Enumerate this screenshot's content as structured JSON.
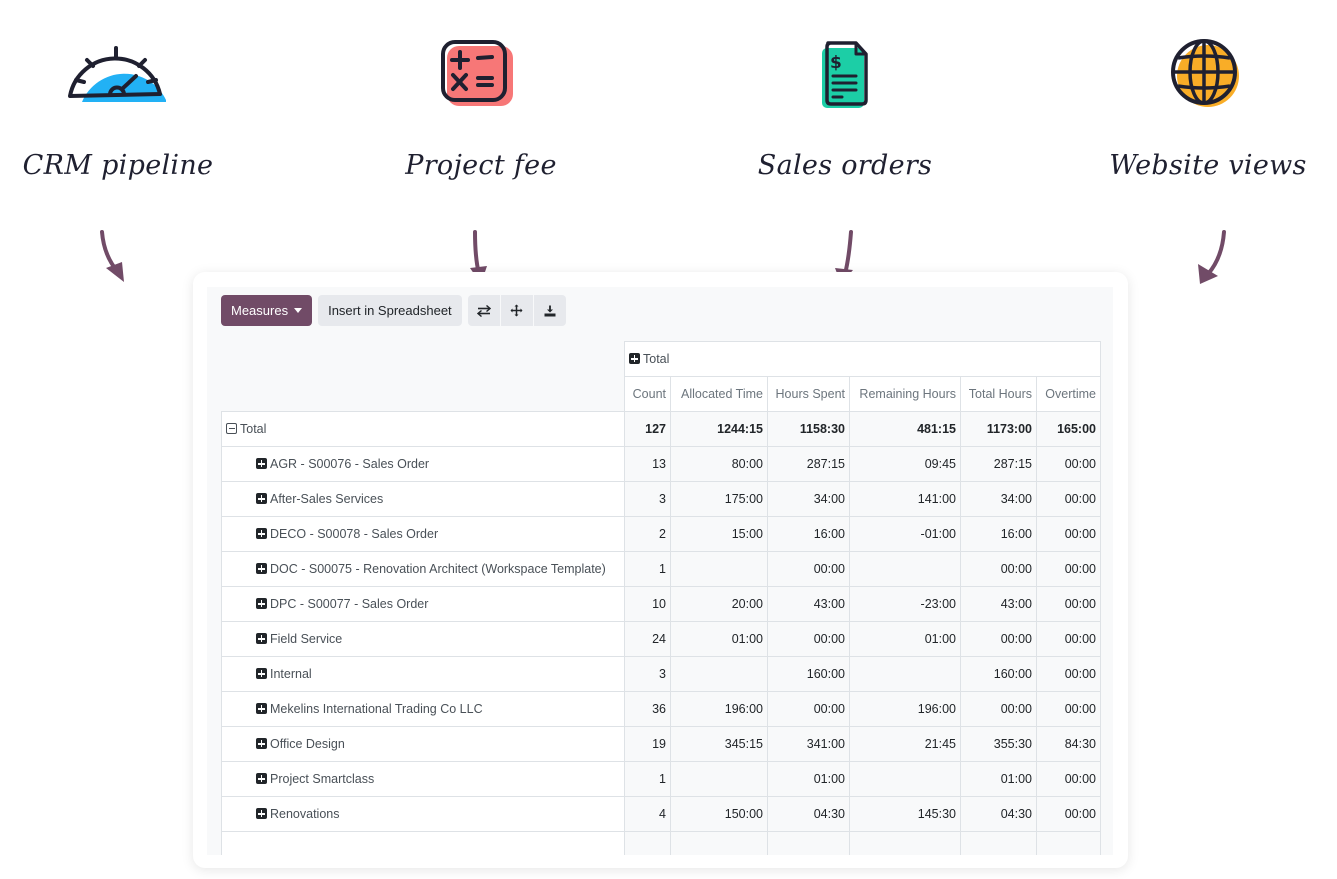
{
  "features": [
    {
      "label": "CRM pipeline",
      "icon": "speedometer-icon",
      "color": "#22b1f5"
    },
    {
      "label": "Project fee",
      "icon": "calculator-icon",
      "color": "#f77777"
    },
    {
      "label": "Sales orders",
      "icon": "invoice-document-icon",
      "color": "#1ccea6"
    },
    {
      "label": "Website views",
      "icon": "globe-icon",
      "color": "#f9ad27"
    }
  ],
  "colors": {
    "accent": "#714b67",
    "arrow": "#714b67",
    "ink": "#1f2030"
  },
  "toolbar": {
    "measures_label": "Measures",
    "insert_label": "Insert in Spreadsheet",
    "flip_axis_icon": "flip-axis-icon",
    "expand_icon": "expand-all-icon",
    "download_icon": "download-icon"
  },
  "pivot": {
    "col_group_label": "Total",
    "columns": [
      "Count",
      "Allocated Time",
      "Hours Spent",
      "Remaining Hours",
      "Total Hours",
      "Overtime"
    ],
    "total_row": {
      "label": "Total",
      "values": [
        "127",
        "1244:15",
        "1158:30",
        "481:15",
        "1173:00",
        "165:00"
      ]
    },
    "rows": [
      {
        "label": "AGR - S00076 - Sales Order",
        "values": [
          "13",
          "80:00",
          "287:15",
          "09:45",
          "287:15",
          "00:00"
        ]
      },
      {
        "label": "After-Sales Services",
        "values": [
          "3",
          "175:00",
          "34:00",
          "141:00",
          "34:00",
          "00:00"
        ]
      },
      {
        "label": "DECO - S00078 - Sales Order",
        "values": [
          "2",
          "15:00",
          "16:00",
          "-01:00",
          "16:00",
          "00:00"
        ]
      },
      {
        "label": "DOC - S00075 - Renovation Architect (Workspace Template)",
        "values": [
          "1",
          "",
          "00:00",
          "",
          "00:00",
          "00:00"
        ]
      },
      {
        "label": "DPC - S00077 - Sales Order",
        "values": [
          "10",
          "20:00",
          "43:00",
          "-23:00",
          "43:00",
          "00:00"
        ]
      },
      {
        "label": "Field Service",
        "values": [
          "24",
          "01:00",
          "00:00",
          "01:00",
          "00:00",
          "00:00"
        ]
      },
      {
        "label": "Internal",
        "values": [
          "3",
          "",
          "160:00",
          "",
          "160:00",
          "00:00"
        ]
      },
      {
        "label": "Mekelins International Trading Co LLC",
        "values": [
          "36",
          "196:00",
          "00:00",
          "196:00",
          "00:00",
          "00:00"
        ]
      },
      {
        "label": "Office Design",
        "values": [
          "19",
          "345:15",
          "341:00",
          "21:45",
          "355:30",
          "84:30"
        ]
      },
      {
        "label": "Project Smartclass",
        "values": [
          "1",
          "",
          "01:00",
          "",
          "01:00",
          "00:00"
        ]
      },
      {
        "label": "Renovations",
        "values": [
          "4",
          "150:00",
          "04:30",
          "145:30",
          "04:30",
          "00:00"
        ]
      }
    ]
  }
}
